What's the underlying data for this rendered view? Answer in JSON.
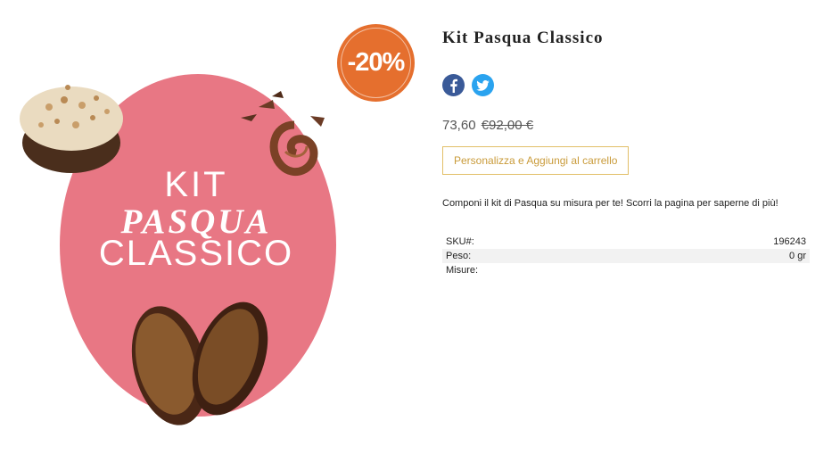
{
  "product": {
    "title": "Kit Pasqua Classico",
    "image": {
      "egg_line1": "KIT",
      "egg_line2": "PASQUA",
      "egg_line3": "CLASSICO"
    },
    "discount_badge": "-20%",
    "price_current": "73,60",
    "price_old": "€92,00 €",
    "add_to_cart_label": "Personalizza e Aggiungi al carrello",
    "description": "Componi il kit di Pasqua su misura per te! Scorri la pagina per saperne di più!",
    "specs": [
      {
        "label": "SKU#:",
        "value": "196243"
      },
      {
        "label": "Peso:",
        "value": "0 gr"
      },
      {
        "label": "Misure:",
        "value": ""
      }
    ]
  },
  "share": {
    "facebook_icon": "facebook-icon",
    "twitter_icon": "twitter-icon"
  },
  "colors": {
    "egg_pink": "#e87784",
    "badge_orange": "#e56f2e",
    "button_gold": "#e2bf68",
    "facebook_blue": "#3a5a98",
    "twitter_blue": "#2aa3ef"
  }
}
